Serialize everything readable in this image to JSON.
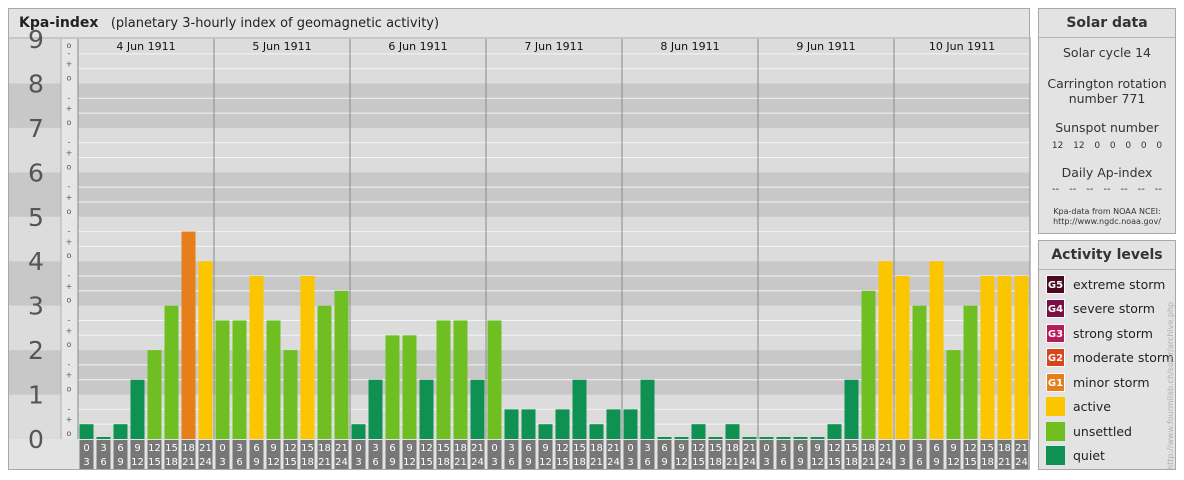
{
  "header": {
    "title": "Kpa-index",
    "subtitle": "(planetary 3-hourly index of geomagnetic activity)"
  },
  "chart_data": {
    "type": "bar",
    "title": "Kpa-index",
    "subtitle": "(planetary 3-hourly index of geomagnetic activity)",
    "ylim": [
      0,
      9
    ],
    "y_ticks": [
      "0",
      "1",
      "2",
      "3",
      "4",
      "5",
      "6",
      "7",
      "8",
      "9"
    ],
    "y_minor_ticks": [
      "o",
      "+",
      "-"
    ],
    "days": [
      "4 Jun 1911",
      "5 Jun 1911",
      "6 Jun 1911",
      "7 Jun 1911",
      "8 Jun 1911",
      "9 Jun 1911",
      "10 Jun 1911"
    ],
    "hour_tick_top": [
      "0",
      "3",
      "6",
      "9",
      "12",
      "15",
      "18",
      "21"
    ],
    "hour_tick_bottom": [
      "3",
      "6",
      "9",
      "12",
      "15",
      "18",
      "21",
      "24"
    ],
    "values": [
      [
        0.333,
        0.0,
        0.333,
        1.333,
        2.0,
        3.0,
        4.667,
        4.0
      ],
      [
        2.667,
        2.667,
        3.667,
        2.667,
        2.0,
        3.667,
        3.0,
        3.333
      ],
      [
        0.333,
        1.333,
        2.333,
        2.333,
        1.333,
        2.667,
        2.667,
        1.333
      ],
      [
        2.667,
        0.667,
        0.667,
        0.333,
        0.667,
        1.333,
        0.333,
        0.667
      ],
      [
        0.667,
        1.333,
        0.0,
        0.0,
        0.333,
        0.0,
        0.333,
        0.0
      ],
      [
        0.0,
        0.0,
        0.0,
        0.0,
        0.333,
        1.333,
        3.333,
        4.0
      ],
      [
        3.667,
        3.0,
        4.0,
        2.0,
        3.0,
        3.667,
        3.667,
        3.667
      ]
    ],
    "colors": {
      "quiet": "#0e9151",
      "unsettled": "#6fbf23",
      "active": "#fbc600",
      "G1": "#e67e1a",
      "G2": "#d9441a",
      "G3": "#b81a5b",
      "G4": "#7a0f46",
      "G5": "#4a0a1f"
    }
  },
  "solar": {
    "title": "Solar data",
    "cycle": "Solar cycle 14",
    "carrington_line1": "Carrington rotation",
    "carrington_line2": "number 771",
    "sunspot_label": "Sunspot number",
    "sunspot_values": [
      "12",
      "12",
      "0",
      "0",
      "0",
      "0",
      "0"
    ],
    "ap_label": "Daily Ap-index",
    "ap_values": [
      "--",
      "--",
      "--",
      "--",
      "--",
      "--",
      "--"
    ],
    "source_line1": "Kpa-data from NOAA NCEI:",
    "source_line2": "http://www.ngdc.noaa.gov/"
  },
  "levels": {
    "title": "Activity levels",
    "items": [
      {
        "badge": "G5",
        "label": "extreme storm",
        "color": "#4a0a1f"
      },
      {
        "badge": "G4",
        "label": "severe storm",
        "color": "#7a0f46"
      },
      {
        "badge": "G3",
        "label": "strong storm",
        "color": "#b81a5b"
      },
      {
        "badge": "G2",
        "label": "moderate storm",
        "color": "#d9441a"
      },
      {
        "badge": "G1",
        "label": "minor storm",
        "color": "#e67e1a"
      },
      {
        "badge": "",
        "label": "active",
        "color": "#fbc600"
      },
      {
        "badge": "",
        "label": "unsettled",
        "color": "#6fbf23"
      },
      {
        "badge": "",
        "label": "quiet",
        "color": "#0e9151"
      }
    ]
  },
  "credit": "http://www.fourmilab.ch/solar/archive.php"
}
